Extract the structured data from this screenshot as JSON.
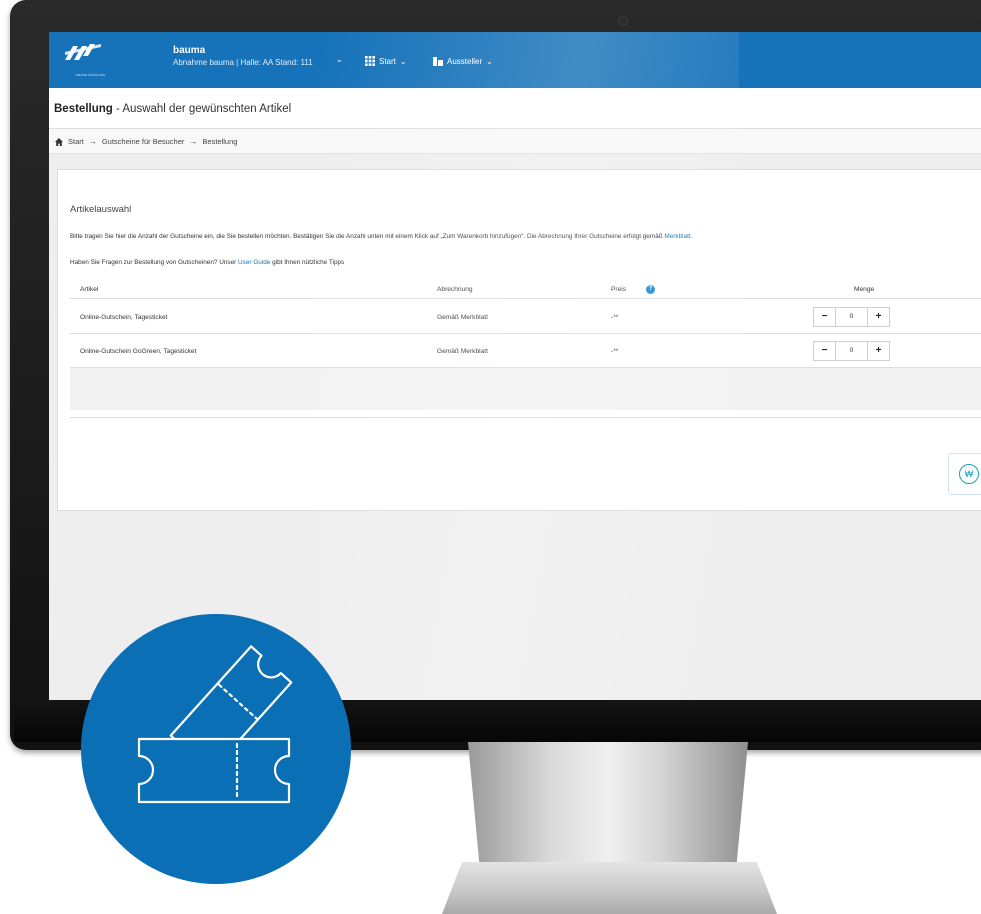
{
  "header": {
    "fair_name": "bauma",
    "fair_detail": "Abnahme bauma | Halle: AA Stand: 111",
    "logo_text": "MESSE MÜNCHEN",
    "nav": [
      {
        "label": "Start"
      },
      {
        "label": "Aussteller"
      }
    ]
  },
  "page": {
    "title_bold": "Bestellung",
    "title_rest": " - Auswahl der gewünschten Artikel"
  },
  "breadcrumb": [
    "Start",
    "Gutscheine für Besucher",
    "Bestellung"
  ],
  "section": {
    "title": "Artikelauswahl",
    "info1": "Bitte tragen Sie hier die Anzahl der Gutscheine ein, die Sie bestellen möchten. Bestätigen Sie die Anzahl unten mit einem Klick auf „Zum Warenkorb hinzufügen“. Die Abrechnung Ihrer Gutscheine erfolgt gemäß ",
    "info1_link": "Merkblatt",
    "info1_end": ".",
    "info2_a": "Haben Sie Fragen zur Bestellung von Gutscheinen? Unser ",
    "info2_link": "User Guide",
    "info2_b": " gibt Ihnen nützliche Tipps"
  },
  "table": {
    "headers": {
      "article": "Artikel",
      "billing": "Abrechnung",
      "price": "Preis",
      "qty": "Menge"
    },
    "rows": [
      {
        "article": "Online-Gutschein, Tagesticket",
        "billing": "Gemäß Merkblatt",
        "price": "-**",
        "qty": "0"
      },
      {
        "article": "Online-Gutschein GoGreen, Tagesticket",
        "billing": "Gemäß Merkblatt",
        "price": "-**",
        "qty": "0"
      }
    ],
    "minus": "−",
    "plus": "+"
  },
  "colors": {
    "brand": "#1672b9",
    "badge": "#0b6fb6",
    "accent": "#19a3b6"
  },
  "icons": {
    "home": "home-icon",
    "cart": "cart-icon",
    "help": "help-icon",
    "grid": "grid-icon",
    "booth": "booth-icon",
    "tickets": "tickets-icon"
  }
}
